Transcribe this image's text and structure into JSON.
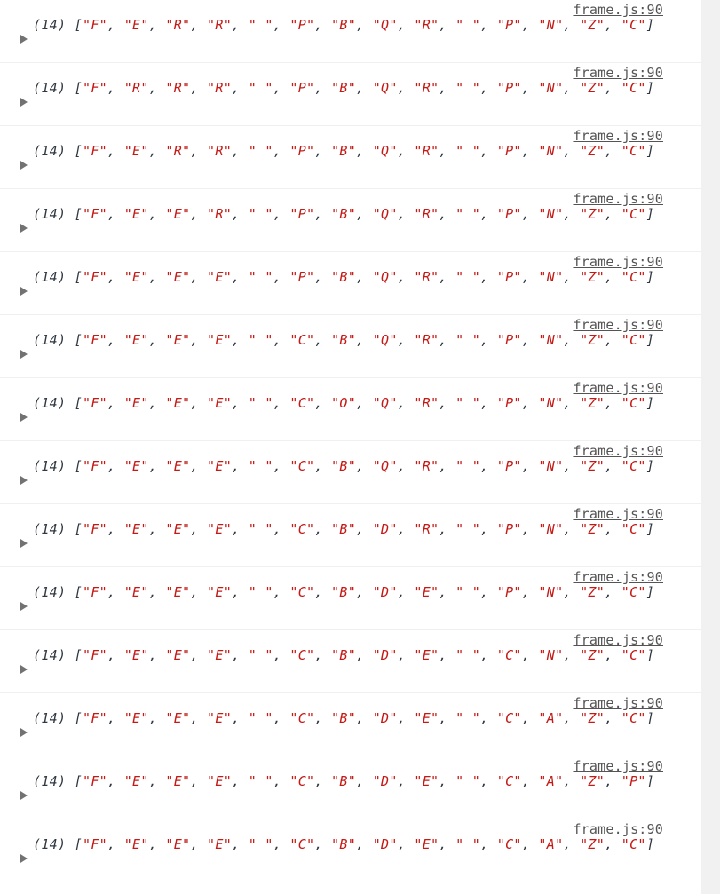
{
  "console": {
    "colors": {
      "string": "#c41a16",
      "source_link": "#545454",
      "triangle": "#727272"
    },
    "source_link_label": "frame.js:90",
    "entries": [
      {
        "count": "(14)",
        "items": [
          "F",
          "E",
          "R",
          "R",
          " ",
          "P",
          "B",
          "Q",
          "R",
          " ",
          "P",
          "N",
          "Z",
          "C"
        ]
      },
      {
        "count": "(14)",
        "items": [
          "F",
          "R",
          "R",
          "R",
          " ",
          "P",
          "B",
          "Q",
          "R",
          " ",
          "P",
          "N",
          "Z",
          "C"
        ]
      },
      {
        "count": "(14)",
        "items": [
          "F",
          "E",
          "R",
          "R",
          " ",
          "P",
          "B",
          "Q",
          "R",
          " ",
          "P",
          "N",
          "Z",
          "C"
        ]
      },
      {
        "count": "(14)",
        "items": [
          "F",
          "E",
          "E",
          "R",
          " ",
          "P",
          "B",
          "Q",
          "R",
          " ",
          "P",
          "N",
          "Z",
          "C"
        ]
      },
      {
        "count": "(14)",
        "items": [
          "F",
          "E",
          "E",
          "E",
          " ",
          "P",
          "B",
          "Q",
          "R",
          " ",
          "P",
          "N",
          "Z",
          "C"
        ]
      },
      {
        "count": "(14)",
        "items": [
          "F",
          "E",
          "E",
          "E",
          " ",
          "C",
          "B",
          "Q",
          "R",
          " ",
          "P",
          "N",
          "Z",
          "C"
        ]
      },
      {
        "count": "(14)",
        "items": [
          "F",
          "E",
          "E",
          "E",
          " ",
          "C",
          "O",
          "Q",
          "R",
          " ",
          "P",
          "N",
          "Z",
          "C"
        ]
      },
      {
        "count": "(14)",
        "items": [
          "F",
          "E",
          "E",
          "E",
          " ",
          "C",
          "B",
          "Q",
          "R",
          " ",
          "P",
          "N",
          "Z",
          "C"
        ]
      },
      {
        "count": "(14)",
        "items": [
          "F",
          "E",
          "E",
          "E",
          " ",
          "C",
          "B",
          "D",
          "R",
          " ",
          "P",
          "N",
          "Z",
          "C"
        ]
      },
      {
        "count": "(14)",
        "items": [
          "F",
          "E",
          "E",
          "E",
          " ",
          "C",
          "B",
          "D",
          "E",
          " ",
          "P",
          "N",
          "Z",
          "C"
        ]
      },
      {
        "count": "(14)",
        "items": [
          "F",
          "E",
          "E",
          "E",
          " ",
          "C",
          "B",
          "D",
          "E",
          " ",
          "C",
          "N",
          "Z",
          "C"
        ]
      },
      {
        "count": "(14)",
        "items": [
          "F",
          "E",
          "E",
          "E",
          " ",
          "C",
          "B",
          "D",
          "E",
          " ",
          "C",
          "A",
          "Z",
          "C"
        ]
      },
      {
        "count": "(14)",
        "items": [
          "F",
          "E",
          "E",
          "E",
          " ",
          "C",
          "B",
          "D",
          "E",
          " ",
          "C",
          "A",
          "Z",
          "P"
        ]
      },
      {
        "count": "(14)",
        "items": [
          "F",
          "E",
          "E",
          "E",
          " ",
          "C",
          "B",
          "D",
          "E",
          " ",
          "C",
          "A",
          "Z",
          "C"
        ]
      }
    ]
  }
}
